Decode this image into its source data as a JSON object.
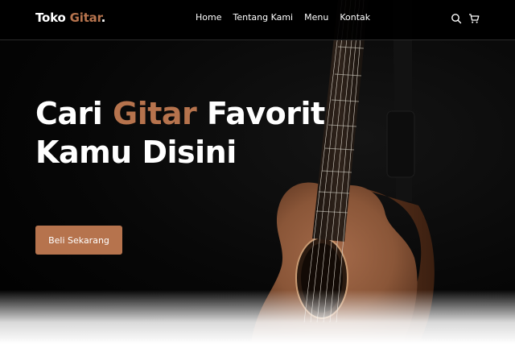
{
  "nav": {
    "logo_main": "Toko",
    "logo_accent": "Gitar",
    "logo_dot": ".",
    "links": [
      "Home",
      "Tentang Kami",
      "Menu",
      "Kontak"
    ],
    "icons": [
      "search-icon",
      "cart-icon"
    ]
  },
  "hero": {
    "line1_pre": "Cari",
    "line1_accent": "Gitar",
    "line1_post": "Favorit",
    "line2": "Kamu Disini",
    "cta_label": "Beli Sekarang"
  },
  "colors": {
    "accent": "#b6734d",
    "background": "#000000",
    "text": "#ffffff"
  }
}
